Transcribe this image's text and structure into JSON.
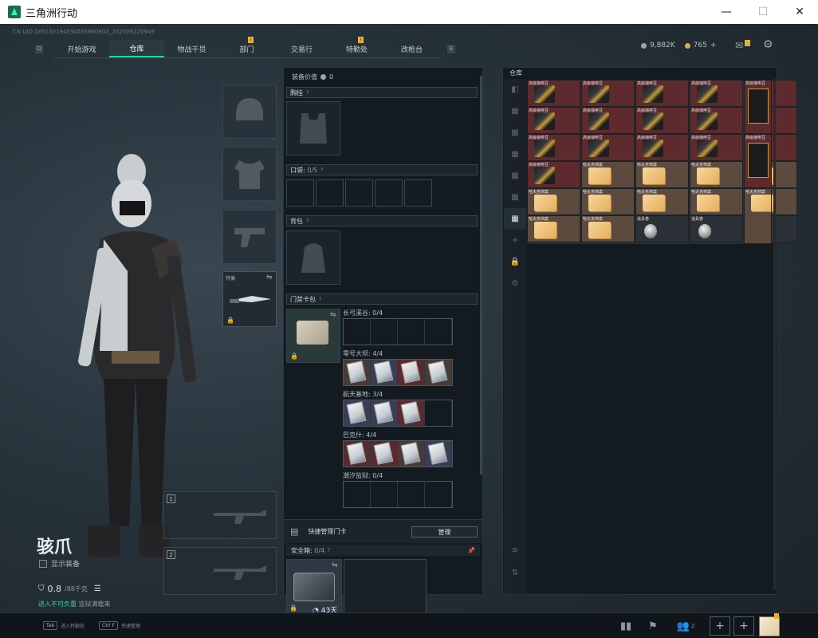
{
  "window": {
    "title": "三角洲行动",
    "minimize": "—",
    "maximize": "☐",
    "close": "✕"
  },
  "uid": "CN UID:185150194534535880902_202509220949",
  "nav": {
    "left_key": "Q",
    "right_key": "E",
    "tabs": [
      {
        "label": "开始游戏",
        "active": false,
        "badge": false
      },
      {
        "label": "仓库",
        "active": true,
        "badge": false
      },
      {
        "label": "物战干员",
        "active": false,
        "badge": false
      },
      {
        "label": "部门",
        "active": false,
        "badge": true
      },
      {
        "label": "交易行",
        "active": false,
        "badge": false
      },
      {
        "label": "特勤处",
        "active": false,
        "badge": true
      },
      {
        "label": "改枪台",
        "active": false,
        "badge": false
      }
    ],
    "badge_text": "!"
  },
  "currency": {
    "silver": "9,882K",
    "gold": "765",
    "gold_add": "+"
  },
  "character": {
    "name": "骇爪",
    "show_equip_label": "显示装备",
    "weight": "0.8",
    "weight_max": "/88千克",
    "status_main": "进入不可负重",
    "status_sub": "监狱满载来",
    "list_icon": "☰"
  },
  "melee": {
    "label": "特偏"
  },
  "weapon_slots": [
    "1",
    "2"
  ],
  "mid": {
    "value_label": "装备价值",
    "value": "0",
    "chest_label": "胸挂",
    "pocket_label": "口袋",
    "pocket_count": "0/5",
    "backpack_label": "背包",
    "keycard_label": "门禁卡包",
    "help": "?",
    "keycard_rows": [
      {
        "label": "长弓溪谷: 0/4",
        "cells": [
          "",
          "",
          "",
          ""
        ]
      },
      {
        "label": "零号大坝: 4/4",
        "cells": [
          "brown",
          "blue",
          "red",
          "brown"
        ]
      },
      {
        "label": "航天基地: 3/4",
        "cells": [
          "blue",
          "blue",
          "red",
          ""
        ]
      },
      {
        "label": "巴克什: 4/4",
        "cells": [
          "red",
          "red",
          "brown",
          "blue"
        ]
      },
      {
        "label": "潮汐监狱: 0/4",
        "cells": [
          "",
          "",
          "",
          ""
        ]
      }
    ],
    "quick_manage": "快捷管理门卡",
    "manage_btn": "管理",
    "safebox_label": "安全箱",
    "safebox_count": "0/4",
    "safebox_timer": "43天"
  },
  "inventory": {
    "title": "仓库",
    "item_labels": {
      "coffee": "高级咖啡豆",
      "doc": "哈夫克档案",
      "grenade": "道具卷",
      "bag_big": "高级咖啡豆",
      "doc_big": "哈夫克档案"
    }
  },
  "bottom": {
    "hint1_key": "Tab",
    "hint1_text": "进入特勤处",
    "hint2_key": "Ctrl F",
    "hint2_text": "快速整理",
    "friends_count": "2"
  }
}
